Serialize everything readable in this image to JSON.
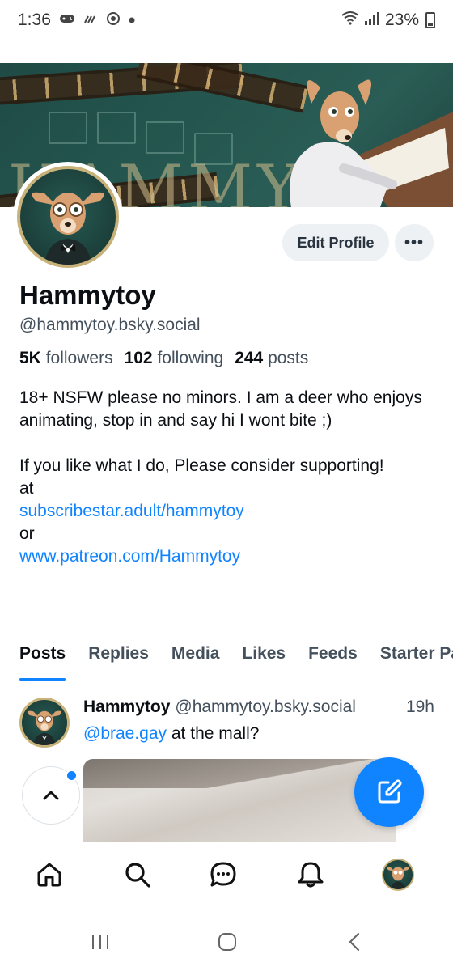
{
  "status_bar": {
    "time": "1:36",
    "battery": "23%"
  },
  "profile": {
    "edit_label": "Edit Profile",
    "more_label": "•••",
    "display_name": "Hammytoy",
    "handle": "@hammytoy.bsky.social",
    "followers_count": "5K",
    "followers_label": "followers",
    "following_count": "102",
    "following_label": "following",
    "posts_count": "244",
    "posts_label": "posts",
    "bio": {
      "line1": "18+ NSFW please no minors. I am a deer who enjoys animating, stop in and say hi I wont bite ;)",
      "line2": "If you like what I do, Please consider supporting!",
      "line3": "at",
      "link1": "subscribestar.adult/hammytoy",
      "line4": "or",
      "link2": "www.patreon.com/Hammytoy"
    }
  },
  "tabs": [
    {
      "label": "Posts",
      "active": true
    },
    {
      "label": "Replies"
    },
    {
      "label": "Media"
    },
    {
      "label": "Likes"
    },
    {
      "label": "Feeds"
    },
    {
      "label": "Starter Packs"
    }
  ],
  "post": {
    "author_name": "Hammytoy",
    "author_handle": "@hammytoy.bsky.social",
    "time": "19h",
    "mention": "@brae.gay",
    "text": " at the mall?"
  },
  "colors": {
    "accent": "#1083fe",
    "banner_green": "#24564f",
    "avatar_ring": "#c8b27a"
  },
  "nav_icons": [
    "home-icon",
    "search-icon",
    "chat-icon",
    "bell-icon",
    "profile-avatar"
  ],
  "system_nav_icons": [
    "recent-apps-icon",
    "home-circle-icon",
    "back-icon"
  ]
}
